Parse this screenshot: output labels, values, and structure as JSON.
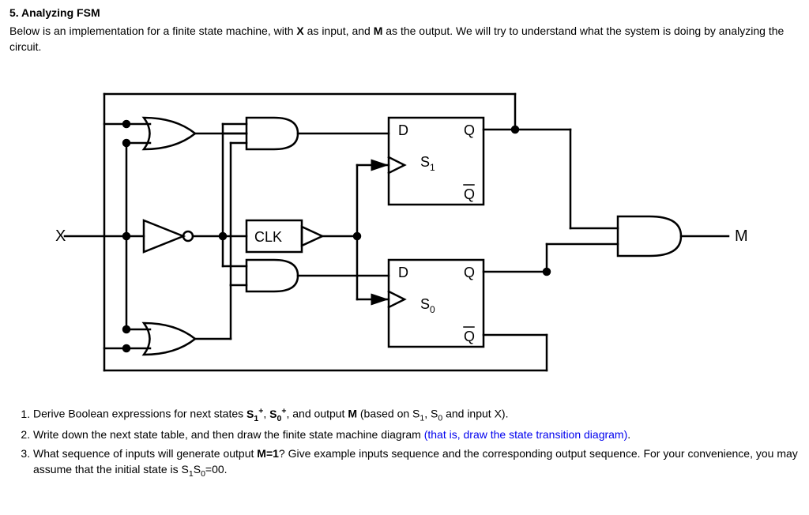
{
  "heading": "5. Analyzing FSM",
  "intro_a": "Below is an implementation for a finite state machine, with ",
  "intro_b": " as input, and ",
  "intro_c": " as the output. We will try to understand what the system is doing by analyzing the circuit.",
  "X_label": "X",
  "M_label": "M",
  "circuit": {
    "X": "X",
    "CLK": "CLK",
    "M": "M",
    "D": "D",
    "Q": "Q",
    "Qbar": "Q",
    "S1": "S",
    "S1sub": "1",
    "S0": "S",
    "S0sub": "0"
  },
  "q1_a": "Derive Boolean expressions for next states ",
  "q1_b": ", and output ",
  "q1_c": " (based on S",
  "q1_d": ", S",
  "q1_e": " and input X).",
  "q2_a": "Write down the next state table, and then draw the finite state machine diagram ",
  "q2_blue": "(that is, draw the state transition diagram)",
  "q2_b": ".",
  "q3_a": "What sequence of inputs will generate output ",
  "q3_b": "? Give example inputs sequence and the corresponding output sequence. For your convenience, you may assume that the initial state is S",
  "q3_c": "S",
  "q3_d": "=00.",
  "S1plus_a": "S",
  "S1plus_sub": "1",
  "S1plus_sup": "+",
  "S0plus_a": "S",
  "S0plus_sub": "0",
  "S0plus_sup": "+",
  "M_bold": "M",
  "M_eq_1": "M=1",
  "sub1": "1",
  "sub0": "0"
}
